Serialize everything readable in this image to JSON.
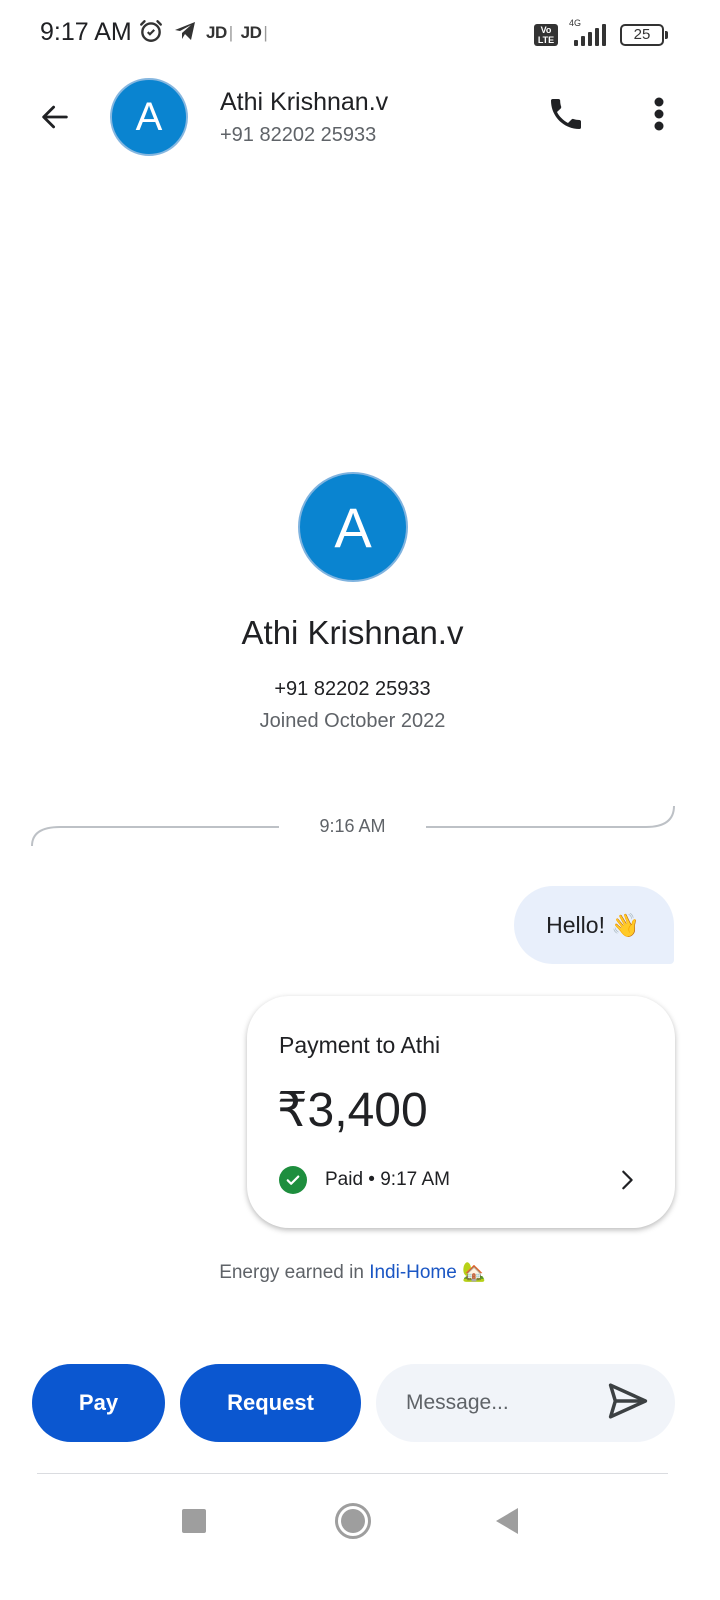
{
  "status_bar": {
    "time": "9:17 AM",
    "icons": [
      "alarm-icon",
      "telegram-icon"
    ],
    "jd_label_1": "JD",
    "jd_label_2": "JD",
    "volte": "Vo LTE",
    "network": "4G",
    "battery": "25"
  },
  "header": {
    "avatar_letter": "A",
    "name": "Athi Krishnan.v",
    "phone": "+91 82202 25933",
    "icons": [
      "back-arrow-icon",
      "phone-icon",
      "more-vert-icon"
    ]
  },
  "profile": {
    "avatar_letter": "A",
    "name": "Athi Krishnan.v",
    "phone": "+91 82202 25933",
    "joined": "Joined October 2022"
  },
  "timeline": {
    "time": "9:16 AM"
  },
  "messages": [
    {
      "text": "Hello! 👋",
      "direction": "sent"
    }
  ],
  "payment": {
    "title": "Payment to Athi",
    "amount": "₹3,400",
    "status": "Paid • 9:17 AM",
    "status_color": "#1e8e3e"
  },
  "energy": {
    "prefix": "Energy earned in ",
    "link": "Indi-Home",
    "emoji": "🏡"
  },
  "actions": {
    "pay_label": "Pay",
    "request_label": "Request",
    "message_placeholder": "Message...",
    "button_color": "#0b57d0"
  },
  "avatar_color": "#0a84d0"
}
